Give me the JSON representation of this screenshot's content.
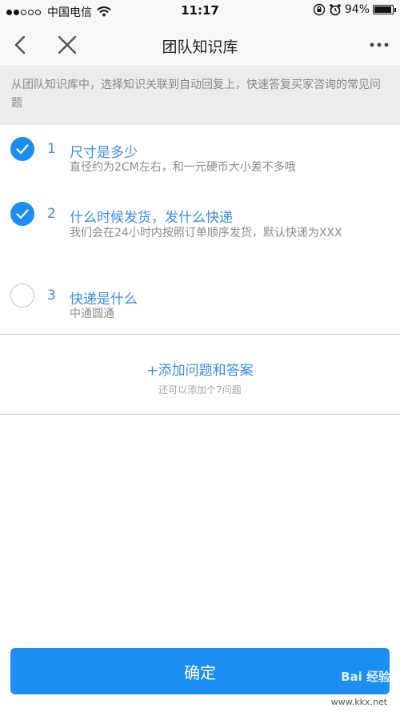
{
  "status_bar": {
    "carrier": "中国电信",
    "time": "11:17",
    "battery": "94%",
    "battery_level": 0.94,
    "signal_dots": [
      true,
      true,
      false,
      false,
      false
    ]
  },
  "nav": {
    "title": "团队知识库",
    "back_icon": "chevron-left-icon",
    "close_icon": "close-icon",
    "more_icon": "more-dots-icon"
  },
  "tip": {
    "text": "从团队知识库中，选择知识关联到自动回复上，快速答复买家咨询的常见问题"
  },
  "qa_items": [
    {
      "number": "1",
      "title": "尺寸是多少",
      "answer": "直径约为2CM左右，和一元硬币大小差不多哦",
      "checked": true
    },
    {
      "number": "2",
      "title": "什么时候发货，发什么快递",
      "answer": "我们会在24小时内按照订单顺序发货，默认快递为XXX",
      "checked": true
    },
    {
      "number": "3",
      "title": "快递是什么",
      "answer": "中通圆通",
      "checked": false
    }
  ],
  "add": {
    "label": "+添加问题和答案",
    "hint": "还可以添加个7问题"
  },
  "confirm_label": "确定",
  "watermark": {
    "brand": "Bai 经验",
    "url": "www.kkx.net"
  },
  "colors": {
    "accent": "#1a8ef3",
    "link": "#3a8ee6"
  }
}
